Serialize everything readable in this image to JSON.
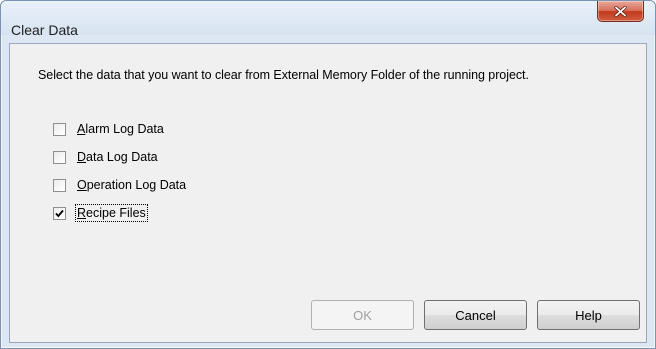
{
  "dialog": {
    "title": "Clear Data",
    "close_icon": "close-x-icon"
  },
  "instruction": "Select the data that you want to clear from External Memory Folder of the running project.",
  "options": [
    {
      "mnemonic": "A",
      "rest": "larm Log Data",
      "checked": false
    },
    {
      "mnemonic": "D",
      "rest": "ata Log Data",
      "checked": false
    },
    {
      "mnemonic": "O",
      "rest": "peration Log Data",
      "checked": false
    },
    {
      "mnemonic": "R",
      "rest": "ecipe Files",
      "checked": true
    }
  ],
  "buttons": {
    "ok_label": "OK",
    "ok_enabled": false,
    "cancel_label": "Cancel",
    "help_label": "Help"
  },
  "colors": {
    "close_button": "#c7432a",
    "frame": "#dce7f3",
    "client": "#f0f0f0"
  }
}
